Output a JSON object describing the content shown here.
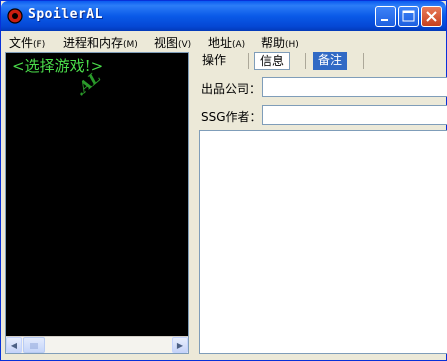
{
  "window": {
    "title": "SpoilerAL"
  },
  "menu": [
    {
      "label": "文件",
      "accel": "(F)"
    },
    {
      "label": "进程和内存",
      "accel": "(M)"
    },
    {
      "label": "视图",
      "accel": "(V)"
    },
    {
      "label": "地址",
      "accel": "(A)"
    },
    {
      "label": "帮助",
      "accel": "(H)"
    }
  ],
  "left_pane": {
    "game_label": "<选择游戏!>",
    "watermark": ".AL"
  },
  "tabs": [
    {
      "label": "操作"
    },
    {
      "label": "信息"
    },
    {
      "label": "备注"
    }
  ],
  "form": {
    "publisher_label": "出品公司：",
    "publisher_value": "",
    "author_label": "SSG作者：",
    "author_value": ""
  },
  "colors": {
    "titlebar": "#0a5ae8",
    "console_bg": "#000000",
    "console_text": "#4adc4a",
    "selected_tab": "#316ac5"
  }
}
